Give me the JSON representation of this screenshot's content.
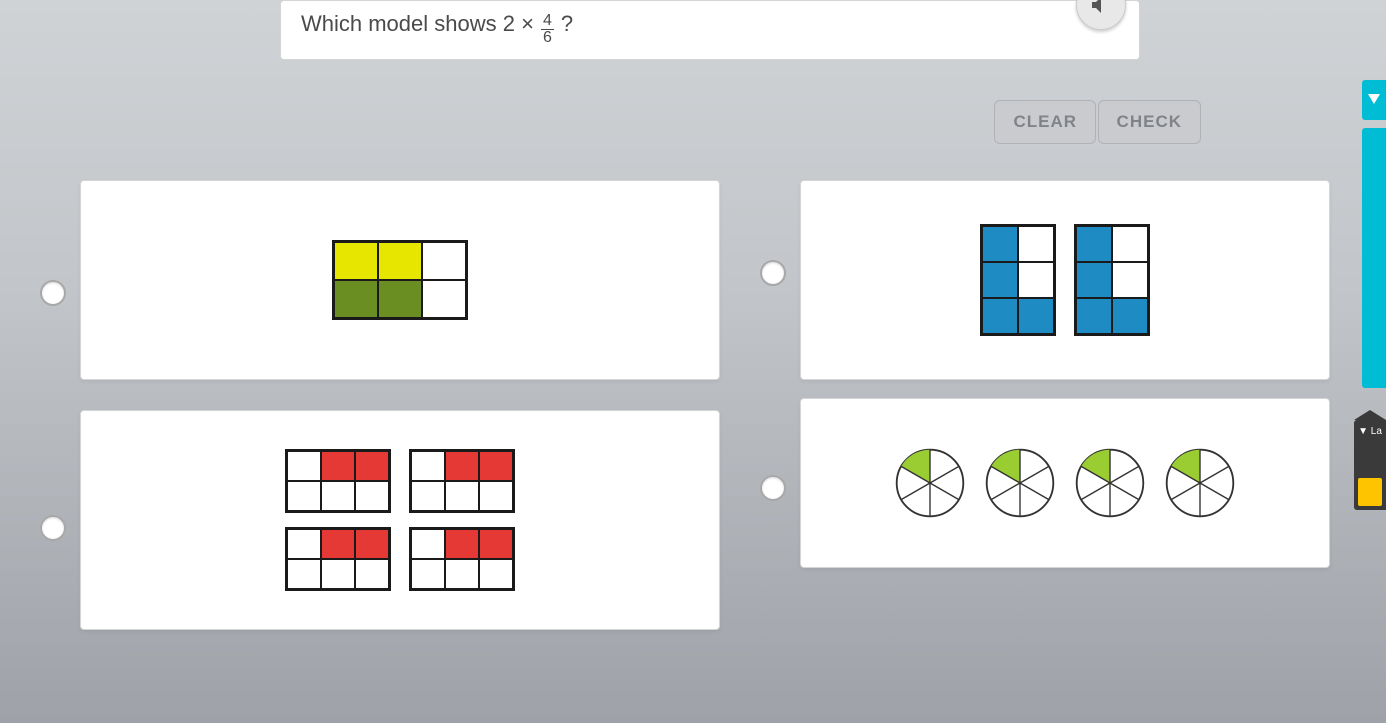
{
  "question": {
    "prefix": "Which model shows 2 ×",
    "fraction_num": "4",
    "fraction_den": "6",
    "suffix": "?"
  },
  "buttons": {
    "clear": "CLEAR",
    "check": "CHECK"
  },
  "side": {
    "la": "▼ La"
  },
  "options": {
    "a": {
      "desc": "one 3x2 grid, 4 of 6 shaded (2 yellow top, 2 olive bottom)",
      "cells": [
        "yellow",
        "yellow",
        "white",
        "olive",
        "olive",
        "white"
      ]
    },
    "b": {
      "desc": "two 2x3 grids, each 4 of 6 shaded blue",
      "grid1": [
        "blue",
        "white",
        "blue",
        "white",
        "blue",
        "blue"
      ],
      "grid2": [
        "blue",
        "white",
        "blue",
        "white",
        "blue",
        "blue"
      ]
    },
    "c": {
      "desc": "four 3x2 grids, each 2 of 6 shaded red on top row",
      "pattern": [
        "white",
        "red",
        "red",
        "white",
        "white",
        "white"
      ]
    },
    "d": {
      "desc": "four circles split into 6, each with 1 slice shaded green",
      "circles": 4,
      "shaded_per_circle": 1,
      "slices": 6
    }
  }
}
